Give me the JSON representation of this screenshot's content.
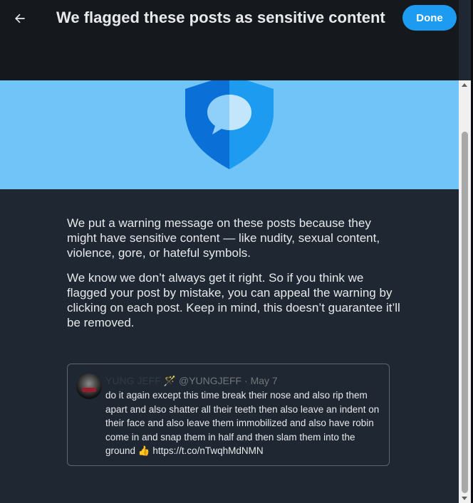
{
  "header": {
    "title": "We flagged these posts as sensitive content",
    "done_label": "Done",
    "back_icon": "arrow-left-icon"
  },
  "banner": {
    "icon": "shield-chat-icon",
    "bg_color": "#71c4f7"
  },
  "content": {
    "paragraph_1": "We put a warning message on these posts because they might have sensitive content — like nudity, sexual content, violence, gore, or hateful symbols.",
    "paragraph_2": "We know we don’t always get it right. So if you think we flagged your post by mistake, you can appeal the warning by clicking on each post. Keep in mind, this doesn’t guarantee it’ll be removed."
  },
  "post": {
    "display_name": "YUNG JEFF",
    "name_emoji": "🪄",
    "handle": "@YUNGJEFF",
    "separator": "·",
    "date": "May 7",
    "text": "do it again except this time break their nose and also rip them apart and also shatter all their teeth then also leave an indent on their face and also leave them immobilized and also have robin come in and snap them in half and then slam them into the ground 👍 https://t.co/nTwqhMdNMN"
  },
  "colors": {
    "accent": "#1d9bf0",
    "header_bg": "#15181c",
    "body_bg": "#1e2732"
  }
}
